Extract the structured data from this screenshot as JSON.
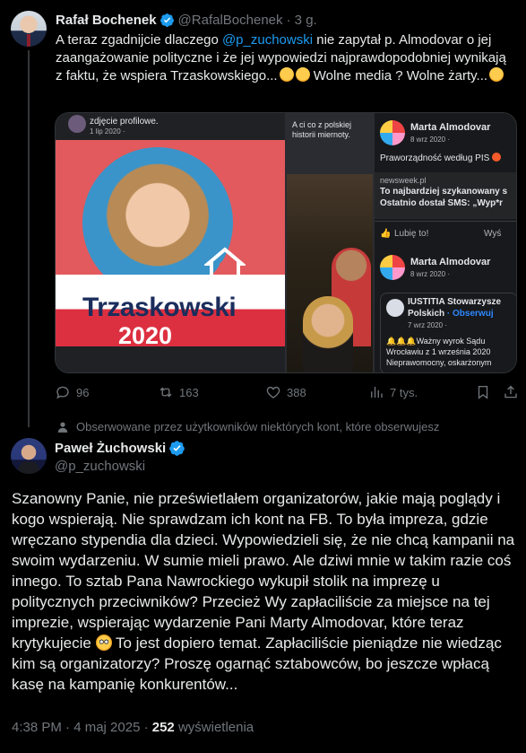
{
  "colors": {
    "background": "#000000",
    "text": "#e7e9ea",
    "muted": "#71767b",
    "accent": "#1d9bf0",
    "border": "#2f3336"
  },
  "first_tweet": {
    "name": "Rafał Bochenek",
    "handle": "@RafalBochenek",
    "time": "· 3 g.",
    "text_part1": "A teraz zgadnijcie dlaczego ",
    "mention": "@p_zuchowski",
    "text_part2": " nie zapytał p. Almodovar o jej zaangażowanie polityczne i że jej wypowiedzi najprawdopodobniej wynikają z faktu, że wspiera Trzaskowskiego...",
    "text_part3": " Wolne media ? Wolne żarty...",
    "media": {
      "left": {
        "caption": "zdjęcie profilowe.",
        "date": "1 lip 2020 ·",
        "poster_line1": "Trzaskowski",
        "poster_line2": "2020"
      },
      "middle": {
        "text": "A ci co z polskiej historii miernoty."
      },
      "right": {
        "post1_name": "Marta Almodovar",
        "post1_date": "8 wrz 2020 ·",
        "post1_text": "Praworządność według PIS",
        "link_source": "newsweek.pl",
        "link_line1": "To najbardziej szykanowany s",
        "link_line2": "Ostatnio dostał SMS: „Wyp*r",
        "like_label": "Lubię to!",
        "share_label": "Wyś",
        "post2_name": "Marta Almodovar",
        "post2_date": "8 wrz 2020 ·",
        "inner_name1": "IUSTITIA Stowarzysze",
        "inner_name2": "Polskich",
        "inner_follow": "· Obserwuj",
        "inner_date": "7 wrz 2020 ·",
        "inner_line1": "Ważny wyrok Sądu",
        "inner_line2": "Wrocławiu z 1 września 2020",
        "inner_line3": "Nieprawomocny, oskarżonym"
      }
    },
    "actions": {
      "replies": "96",
      "reposts": "163",
      "likes": "388",
      "views": "7 tys."
    }
  },
  "social_context": "Obserwowane przez użytkowników niektórych kont, które obserwujesz",
  "main_tweet": {
    "name": "Paweł Żuchowski",
    "handle": "@p_zuchowski",
    "text_part1": "Szanowny Panie, nie prześwietlałem organizatorów, jakie mają poglądy i kogo wspierają. Nie sprawdzam ich kont na FB. To była impreza, gdzie wręczano stypendia dla dzieci. Wypowiedzieli się, że nie chcą kampanii na swoim wydarzeniu. W sumie mieli prawo. Ale dziwi mnie w takim razie coś innego. To sztab Pana Nawrockiego wykupił stolik na imprezę u politycznych przeciwników? Przecież Wy zapłaciliście za miejsce na tej imprezie, wspierając wydarzenie Pani Marty Almodovar, które teraz krytykujecie ",
    "text_part2": " To jest dopiero temat. Zapłaciliście pieniądze nie wiedząc kim są organizatorzy?  Proszę ogarnąć sztabowców, bo jeszcze wpłacą kasę na kampanię konkurentów...",
    "timestamp": "4:38 PM · 4 maj 2025 · ",
    "views_count": "252",
    "views_label": " wyświetlenia"
  }
}
